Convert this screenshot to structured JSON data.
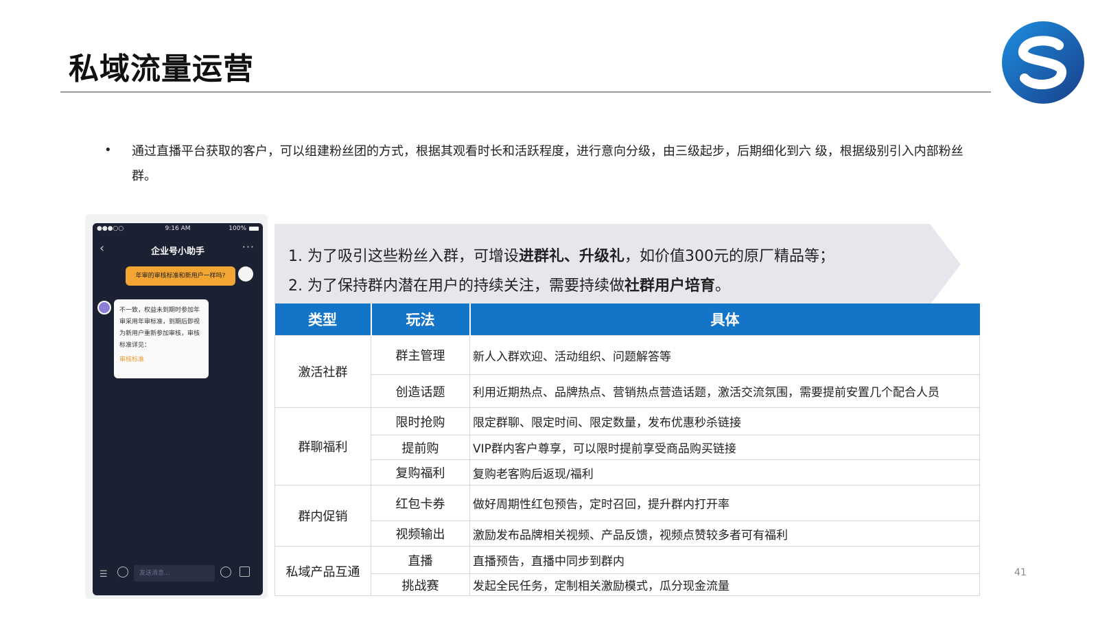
{
  "page": {
    "title": "私域流量运营",
    "page_number": "41"
  },
  "intro": {
    "bullet": "•",
    "text": "通过直播平台获取的客户，可以组建粉丝团的方式，根据其观看时长和活跃程度，进行意向分级，由三级起步，后期细化到六 级，根据级别引入内部粉丝群。"
  },
  "phone": {
    "status_signal": "●●●○○",
    "status_time": "9:16 AM",
    "status_battery": "100%",
    "nav_back": "‹",
    "nav_title": "企业号小助手",
    "nav_more": "···",
    "msg_out": "年审的审核标准和新用户一样吗?",
    "msg_in": "不一致，权益未到期时参加年审采用年审标准，到期后即视为新用户重新参加审核，审核标准详见：",
    "msg_in_link": "审核标准",
    "input_placeholder": "发送消息..."
  },
  "banner": {
    "line1_pre": "1. 为了吸引这些粉丝入群，可增设",
    "line1_bold": "进群礼、升级礼",
    "line1_post": "，如价值300元的原厂精品等；",
    "line2_pre": "2. 为了保持群内潜在用户的持续关注，需要持续做",
    "line2_bold": "社群用户培育",
    "line2_post": "。"
  },
  "table": {
    "headers": [
      "类型",
      "玩法",
      "具体"
    ],
    "groups": [
      {
        "category": "激活社群",
        "rows": [
          {
            "play": "群主管理",
            "detail": "新人入群欢迎、活动组织、问题解答等"
          },
          {
            "play": "创造话题",
            "detail": "利用近期热点、品牌热点、营销热点营造话题，激活交流氛围，需要提前安置几个配合人员"
          }
        ]
      },
      {
        "category": "群聊福利",
        "rows": [
          {
            "play": "限时抢购",
            "detail": "限定群聊、限定时间、限定数量，发布优惠秒杀链接"
          },
          {
            "play": "提前购",
            "detail": "VIP群内客户尊享，可以限时提前享受商品购买链接"
          },
          {
            "play": "复购福利",
            "detail": "复购老客购后返现/福利"
          }
        ]
      },
      {
        "category": "群内促销",
        "rows": [
          {
            "play": "红包卡券",
            "detail": "做好周期性红包预告，定时召回，提升群内打开率"
          },
          {
            "play": "视频输出",
            "detail": "激励发布品牌相关视频、产品反馈，视频点赞较多者可有福利"
          }
        ]
      },
      {
        "category": "私域产品互通",
        "rows": [
          {
            "play": "直播",
            "detail": "直播预告，直播中同步到群内"
          },
          {
            "play": "挑战赛",
            "detail": "发起全民任务，定制相关激励模式，瓜分现金流量"
          }
        ]
      }
    ]
  },
  "colors": {
    "header_blue": "#1474c8",
    "banner_gray": "#e6e7ec",
    "phone_bg": "#1c2033",
    "bubble_orange": "#f3a533"
  }
}
